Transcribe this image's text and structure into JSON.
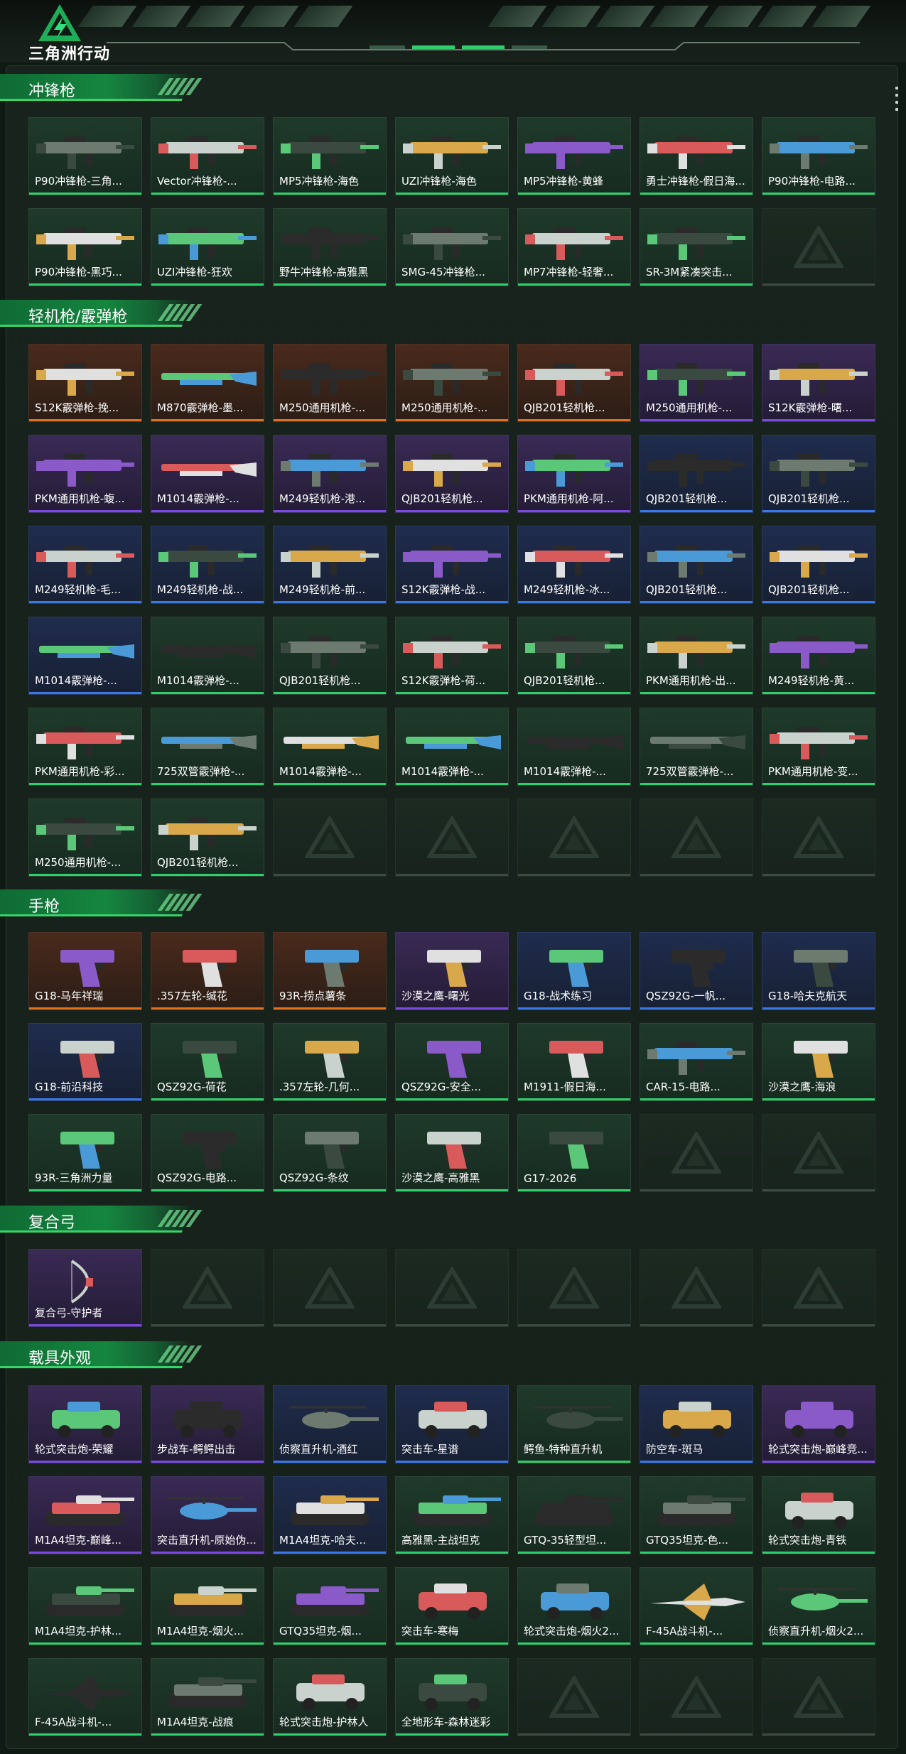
{
  "app": {
    "logo_text": "三角洲行动"
  },
  "sections": [
    {
      "title": "冲锋枪",
      "items": [
        {
          "label": "P90冲锋枪-三角...",
          "rarity": "green",
          "kind": "smg"
        },
        {
          "label": "Vector冲锋枪-...",
          "rarity": "green",
          "kind": "smg"
        },
        {
          "label": "MP5冲锋枪-海色",
          "rarity": "green",
          "kind": "smg"
        },
        {
          "label": "UZI冲锋枪-海色",
          "rarity": "green",
          "kind": "smg"
        },
        {
          "label": "MP5冲锋枪-黄蜂",
          "rarity": "green",
          "kind": "smg"
        },
        {
          "label": "勇士冲锋枪-假日海...",
          "rarity": "green",
          "kind": "smg"
        },
        {
          "label": "P90冲锋枪-电路...",
          "rarity": "green",
          "kind": "smg"
        },
        {
          "label": "P90冲锋枪-黑巧...",
          "rarity": "green",
          "kind": "smg"
        },
        {
          "label": "UZI冲锋枪-狂欢",
          "rarity": "green",
          "kind": "smg"
        },
        {
          "label": "野牛冲锋枪-高雅黑",
          "rarity": "green",
          "kind": "smg"
        },
        {
          "label": "SMG-45冲锋枪...",
          "rarity": "green",
          "kind": "smg"
        },
        {
          "label": "MP7冲锋枪-轻奢...",
          "rarity": "green",
          "kind": "smg"
        },
        {
          "label": "SR-3M紧凑突击...",
          "rarity": "green",
          "kind": "smg"
        },
        {
          "label": "",
          "rarity": "empty",
          "kind": "empty"
        }
      ]
    },
    {
      "title": "轻机枪/霰弹枪",
      "items": [
        {
          "label": "S12K霰弹枪-挽...",
          "rarity": "orange",
          "kind": "rifle"
        },
        {
          "label": "M870霰弹枪-墨...",
          "rarity": "orange",
          "kind": "shotgun"
        },
        {
          "label": "M250通用机枪-...",
          "rarity": "orange",
          "kind": "rifle"
        },
        {
          "label": "M250通用机枪-...",
          "rarity": "orange",
          "kind": "rifle"
        },
        {
          "label": "QJB201轻机枪...",
          "rarity": "orange",
          "kind": "rifle"
        },
        {
          "label": "M250通用机枪-...",
          "rarity": "purple",
          "kind": "rifle"
        },
        {
          "label": "S12K霰弹枪-曙...",
          "rarity": "purple",
          "kind": "rifle"
        },
        {
          "label": "PKM通用机枪-蝮...",
          "rarity": "purple",
          "kind": "rifle"
        },
        {
          "label": "M1014霰弹枪-...",
          "rarity": "purple",
          "kind": "shotgun"
        },
        {
          "label": "M249轻机枪-港...",
          "rarity": "purple",
          "kind": "rifle"
        },
        {
          "label": "QJB201轻机枪...",
          "rarity": "purple",
          "kind": "rifle"
        },
        {
          "label": "PKM通用机枪-阿...",
          "rarity": "purple",
          "kind": "rifle"
        },
        {
          "label": "QJB201轻机枪...",
          "rarity": "blue",
          "kind": "rifle"
        },
        {
          "label": "QJB201轻机枪...",
          "rarity": "blue",
          "kind": "rifle"
        },
        {
          "label": "M249轻机枪-毛...",
          "rarity": "blue",
          "kind": "rifle"
        },
        {
          "label": "M249轻机枪-战...",
          "rarity": "blue",
          "kind": "rifle"
        },
        {
          "label": "M249轻机枪-前...",
          "rarity": "blue",
          "kind": "rifle"
        },
        {
          "label": "S12K霰弹枪-战...",
          "rarity": "blue",
          "kind": "rifle"
        },
        {
          "label": "M249轻机枪-冰...",
          "rarity": "blue",
          "kind": "rifle"
        },
        {
          "label": "QJB201轻机枪...",
          "rarity": "blue",
          "kind": "rifle"
        },
        {
          "label": "QJB201轻机枪...",
          "rarity": "blue",
          "kind": "rifle"
        },
        {
          "label": "M1014霰弹枪-...",
          "rarity": "blue",
          "kind": "shotgun"
        },
        {
          "label": "M1014霰弹枪-...",
          "rarity": "green",
          "kind": "shotgun"
        },
        {
          "label": "QJB201轻机枪...",
          "rarity": "green",
          "kind": "rifle"
        },
        {
          "label": "S12K霰弹枪-荷...",
          "rarity": "green",
          "kind": "rifle"
        },
        {
          "label": "QJB201轻机枪...",
          "rarity": "green",
          "kind": "rifle"
        },
        {
          "label": "PKM通用机枪-出...",
          "rarity": "green",
          "kind": "rifle"
        },
        {
          "label": "M249轻机枪-黄...",
          "rarity": "green",
          "kind": "rifle"
        },
        {
          "label": "PKM通用机枪-彩...",
          "rarity": "green",
          "kind": "rifle"
        },
        {
          "label": "725双管霰弹枪-...",
          "rarity": "green",
          "kind": "shotgun"
        },
        {
          "label": "M1014霰弹枪-...",
          "rarity": "green",
          "kind": "shotgun"
        },
        {
          "label": "M1014霰弹枪-...",
          "rarity": "green",
          "kind": "shotgun"
        },
        {
          "label": "M1014霰弹枪-...",
          "rarity": "green",
          "kind": "shotgun"
        },
        {
          "label": "725双管霰弹枪-...",
          "rarity": "green",
          "kind": "shotgun"
        },
        {
          "label": "PKM通用机枪-变...",
          "rarity": "green",
          "kind": "rifle"
        },
        {
          "label": "M250通用机枪-...",
          "rarity": "green",
          "kind": "rifle"
        },
        {
          "label": "QJB201轻机枪...",
          "rarity": "green",
          "kind": "rifle"
        },
        {
          "label": "",
          "rarity": "empty",
          "kind": "empty"
        },
        {
          "label": "",
          "rarity": "empty",
          "kind": "empty"
        },
        {
          "label": "",
          "rarity": "empty",
          "kind": "empty"
        },
        {
          "label": "",
          "rarity": "empty",
          "kind": "empty"
        },
        {
          "label": "",
          "rarity": "empty",
          "kind": "empty"
        }
      ]
    },
    {
      "title": "手枪",
      "items": [
        {
          "label": "G18-马年祥瑞",
          "rarity": "orange",
          "kind": "pistol"
        },
        {
          "label": ".357左轮-缄花",
          "rarity": "orange",
          "kind": "pistol"
        },
        {
          "label": "93R-捞点薯条",
          "rarity": "orange",
          "kind": "pistol"
        },
        {
          "label": "沙漠之鹰-曙光",
          "rarity": "purple",
          "kind": "pistol"
        },
        {
          "label": "G18-战术练习",
          "rarity": "blue",
          "kind": "pistol"
        },
        {
          "label": "QSZ92G-一帆...",
          "rarity": "blue",
          "kind": "pistol"
        },
        {
          "label": "G18-哈夫克航天",
          "rarity": "blue",
          "kind": "pistol"
        },
        {
          "label": "G18-前沿科技",
          "rarity": "blue",
          "kind": "pistol"
        },
        {
          "label": "QSZ92G-荷花",
          "rarity": "green",
          "kind": "pistol"
        },
        {
          "label": ".357左轮-几何...",
          "rarity": "green",
          "kind": "pistol"
        },
        {
          "label": "QSZ92G-安全...",
          "rarity": "green",
          "kind": "pistol"
        },
        {
          "label": "M1911-假日海...",
          "rarity": "green",
          "kind": "pistol"
        },
        {
          "label": "CAR-15-电路...",
          "rarity": "green",
          "kind": "rifle"
        },
        {
          "label": "沙漠之鹰-海浪",
          "rarity": "green",
          "kind": "pistol"
        },
        {
          "label": "93R-三角洲力量",
          "rarity": "green",
          "kind": "pistol"
        },
        {
          "label": "QSZ92G-电路...",
          "rarity": "green",
          "kind": "pistol"
        },
        {
          "label": "QSZ92G-条纹",
          "rarity": "green",
          "kind": "pistol"
        },
        {
          "label": "沙漠之鹰-高雅黑",
          "rarity": "green",
          "kind": "pistol"
        },
        {
          "label": "G17-2026",
          "rarity": "green",
          "kind": "pistol"
        },
        {
          "label": "",
          "rarity": "empty",
          "kind": "empty"
        },
        {
          "label": "",
          "rarity": "empty",
          "kind": "empty"
        }
      ]
    },
    {
      "title": "复合弓",
      "items": [
        {
          "label": "复合弓-守护者",
          "rarity": "purple",
          "kind": "bow"
        },
        {
          "label": "",
          "rarity": "empty",
          "kind": "empty"
        },
        {
          "label": "",
          "rarity": "empty",
          "kind": "empty"
        },
        {
          "label": "",
          "rarity": "empty",
          "kind": "empty"
        },
        {
          "label": "",
          "rarity": "empty",
          "kind": "empty"
        },
        {
          "label": "",
          "rarity": "empty",
          "kind": "empty"
        },
        {
          "label": "",
          "rarity": "empty",
          "kind": "empty"
        }
      ]
    },
    {
      "title": "载具外观",
      "items": [
        {
          "label": "轮式突击炮-荣耀",
          "rarity": "purple",
          "kind": "vehicle"
        },
        {
          "label": "步战车-鳄鳄出击",
          "rarity": "purple",
          "kind": "vehicle"
        },
        {
          "label": "侦察直升机-酒红",
          "rarity": "blue",
          "kind": "heli"
        },
        {
          "label": "突击车-星谱",
          "rarity": "blue",
          "kind": "vehicle"
        },
        {
          "label": "鳄鱼-特种直升机",
          "rarity": "green",
          "kind": "heli"
        },
        {
          "label": "防空车-斑马",
          "rarity": "blue",
          "kind": "vehicle"
        },
        {
          "label": "轮式突击炮-巅峰竞...",
          "rarity": "purple",
          "kind": "vehicle"
        },
        {
          "label": "M1A4坦克-巅峰...",
          "rarity": "purple",
          "kind": "tank"
        },
        {
          "label": "突击直升机-原始伪...",
          "rarity": "purple",
          "kind": "heli"
        },
        {
          "label": "M1A4坦克-哈夫...",
          "rarity": "blue",
          "kind": "tank"
        },
        {
          "label": "高雅黑-主战坦克",
          "rarity": "green",
          "kind": "tank"
        },
        {
          "label": "GTQ-35轻型坦...",
          "rarity": "green",
          "kind": "tank"
        },
        {
          "label": "GTQ35坦克-色...",
          "rarity": "green",
          "kind": "tank"
        },
        {
          "label": "轮式突击炮-青铁",
          "rarity": "green",
          "kind": "vehicle"
        },
        {
          "label": "M1A4坦克-护林...",
          "rarity": "green",
          "kind": "tank"
        },
        {
          "label": "M1A4坦克-烟火...",
          "rarity": "green",
          "kind": "tank"
        },
        {
          "label": "GTQ35坦克-烟...",
          "rarity": "green",
          "kind": "tank"
        },
        {
          "label": "突击车-寒梅",
          "rarity": "green",
          "kind": "vehicle"
        },
        {
          "label": "轮式突击炮-烟火2...",
          "rarity": "green",
          "kind": "vehicle"
        },
        {
          "label": "F-45A战斗机-...",
          "rarity": "green",
          "kind": "jet"
        },
        {
          "label": "侦察直升机-烟火2...",
          "rarity": "green",
          "kind": "heli"
        },
        {
          "label": "F-45A战斗机-...",
          "rarity": "green",
          "kind": "jet"
        },
        {
          "label": "M1A4坦克-战痕",
          "rarity": "green",
          "kind": "tank"
        },
        {
          "label": "轮式突击炮-护林人",
          "rarity": "green",
          "kind": "vehicle"
        },
        {
          "label": "全地形车-森林迷彩",
          "rarity": "green",
          "kind": "vehicle"
        },
        {
          "label": "",
          "rarity": "empty",
          "kind": "empty"
        },
        {
          "label": "",
          "rarity": "empty",
          "kind": "empty"
        },
        {
          "label": "",
          "rarity": "empty",
          "kind": "empty"
        }
      ]
    }
  ],
  "colors": {
    "accent_green": "#2fcf6b",
    "rarity_orange": "#e0711e",
    "rarity_purple": "#7b4be0",
    "rarity_blue": "#3a78e6",
    "background": "#101a14"
  }
}
